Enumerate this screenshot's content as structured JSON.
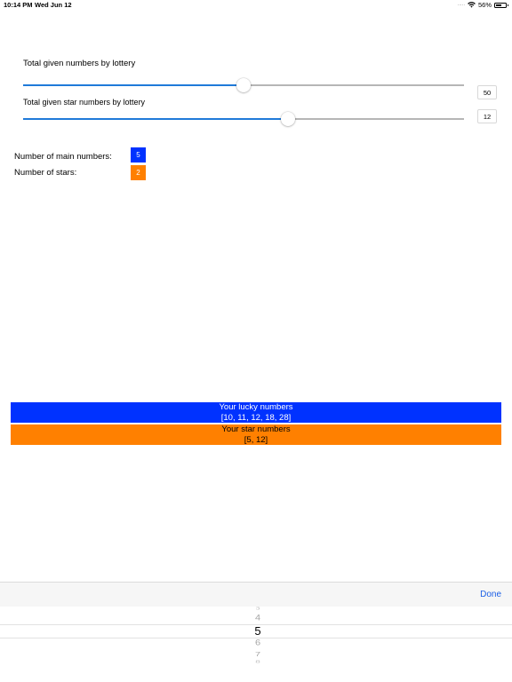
{
  "status_bar": {
    "time": "10:14 PM",
    "date": "Wed Jun 12",
    "battery": "56%",
    "battery_level": 0.56
  },
  "sliders": [
    {
      "label": "Total given numbers by lottery",
      "value": "50",
      "fraction": 0.5
    },
    {
      "label": "Total given star numbers by lottery",
      "value": "12",
      "fraction": 0.6
    }
  ],
  "counts": {
    "main_label": "Number of main numbers:",
    "main_value": "5",
    "stars_label": "Number of stars:",
    "stars_value": "2"
  },
  "results": {
    "lucky_title": "Your lucky numbers",
    "lucky_numbers": "[10, 11, 12, 18, 28]",
    "star_title": "Your star numbers",
    "star_numbers": "[5, 12]"
  },
  "picker": {
    "done_label": "Done",
    "items": [
      "3",
      "4",
      "5",
      "6",
      "7",
      "8"
    ],
    "selected": "5"
  },
  "colors": {
    "main": "#0032ff",
    "stars": "#ff8000",
    "slider": "#1f7ad9",
    "done": "#1b5fe6"
  }
}
